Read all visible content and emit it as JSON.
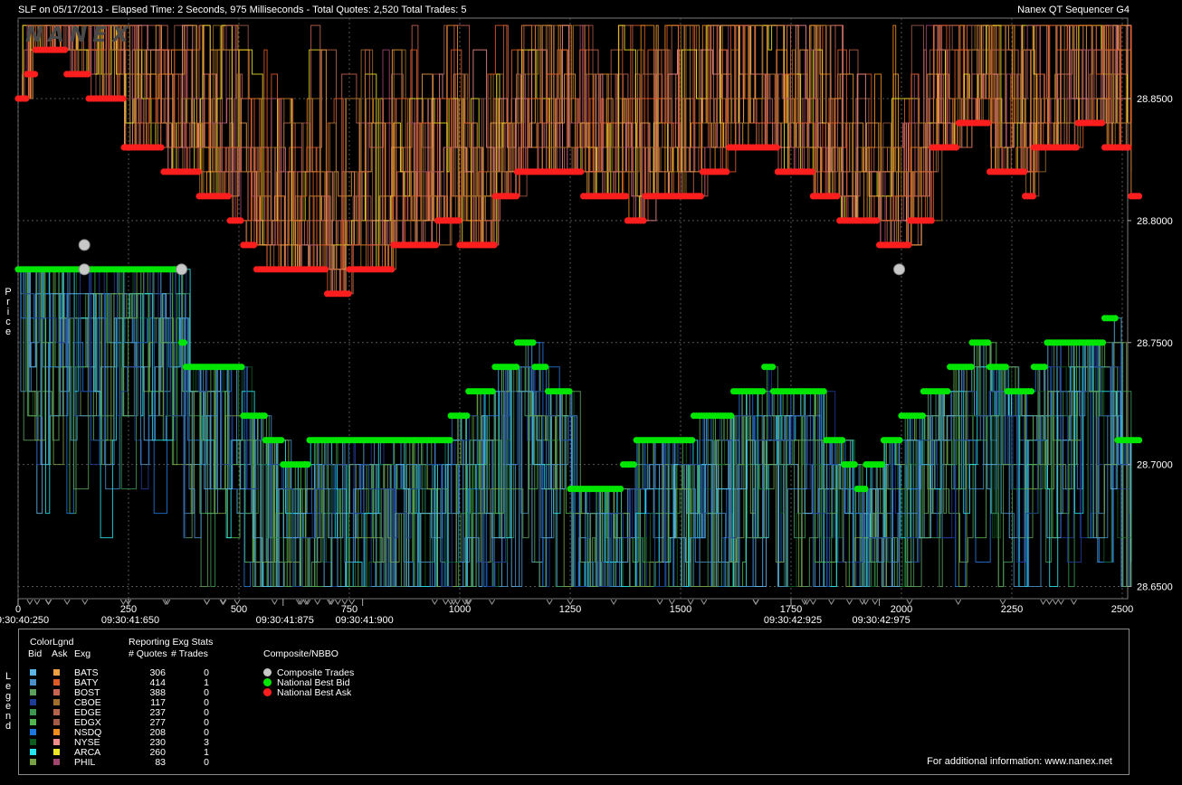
{
  "header": {
    "title": "SLF on 05/17/2013  -  Elapsed Time: 2 Seconds, 975 Milliseconds  -  Total Quotes: 2,520  Total Trades: 5",
    "brand": "Nanex QT Sequencer G4"
  },
  "logo_text": "NANEX",
  "side_labels": {
    "price": "Price",
    "legend": "Legend"
  },
  "chart_data": {
    "type": "line",
    "ylim": [
      28.645,
      28.883
    ],
    "xlim": [
      0,
      2520
    ],
    "y_ticks": [
      "28.6500",
      "28.7000",
      "28.7500",
      "28.8000",
      "28.8500"
    ],
    "x_ticks": [
      "0",
      "250",
      "500",
      "750",
      "1000",
      "1250",
      "1500",
      "1750",
      "2000",
      "2250",
      "2500"
    ],
    "time_labels": [
      {
        "seq": 0,
        "text": "09:30:40:250"
      },
      {
        "seq": 250,
        "text": "09:30:41:650"
      },
      {
        "seq": 600,
        "text": "09:30:41:875"
      },
      {
        "seq": 780,
        "text": "09:30:41:900"
      },
      {
        "seq": 1750,
        "text": "09:30:42:925"
      },
      {
        "seq": 1950,
        "text": "09:30:42:975"
      }
    ],
    "trades": [
      {
        "seq": 150,
        "price": 28.79
      },
      {
        "seq": 150,
        "price": 28.78
      },
      {
        "seq": 370,
        "price": 28.78
      },
      {
        "seq": 1995,
        "price": 28.78
      }
    ],
    "national_best_bid": [
      [
        0,
        28.78
      ],
      [
        370,
        28.75
      ],
      [
        380,
        28.74
      ],
      [
        510,
        28.72
      ],
      [
        560,
        28.71
      ],
      [
        600,
        28.7
      ],
      [
        650,
        28.7
      ],
      [
        660,
        28.71
      ],
      [
        980,
        28.72
      ],
      [
        1020,
        28.73
      ],
      [
        1080,
        28.74
      ],
      [
        1130,
        28.75
      ],
      [
        1170,
        28.74
      ],
      [
        1200,
        28.73
      ],
      [
        1250,
        28.69
      ],
      [
        1370,
        28.7
      ],
      [
        1400,
        28.71
      ],
      [
        1530,
        28.72
      ],
      [
        1620,
        28.73
      ],
      [
        1690,
        28.74
      ],
      [
        1710,
        28.73
      ],
      [
        1830,
        28.71
      ],
      [
        1870,
        28.7
      ],
      [
        1900,
        28.69
      ],
      [
        1920,
        28.7
      ],
      [
        1960,
        28.71
      ],
      [
        2000,
        28.72
      ],
      [
        2050,
        28.73
      ],
      [
        2110,
        28.74
      ],
      [
        2160,
        28.75
      ],
      [
        2200,
        28.74
      ],
      [
        2240,
        28.73
      ],
      [
        2300,
        28.74
      ],
      [
        2330,
        28.75
      ],
      [
        2460,
        28.76
      ],
      [
        2490,
        28.71
      ],
      [
        2540,
        28.71
      ]
    ],
    "national_best_ask": [
      [
        0,
        28.85
      ],
      [
        20,
        28.86
      ],
      [
        40,
        28.87
      ],
      [
        110,
        28.86
      ],
      [
        160,
        28.85
      ],
      [
        240,
        28.83
      ],
      [
        330,
        28.82
      ],
      [
        410,
        28.81
      ],
      [
        480,
        28.8
      ],
      [
        510,
        28.79
      ],
      [
        540,
        28.78
      ],
      [
        700,
        28.77
      ],
      [
        750,
        28.78
      ],
      [
        850,
        28.79
      ],
      [
        950,
        28.8
      ],
      [
        1000,
        28.79
      ],
      [
        1080,
        28.81
      ],
      [
        1130,
        28.82
      ],
      [
        1280,
        28.81
      ],
      [
        1380,
        28.8
      ],
      [
        1420,
        28.81
      ],
      [
        1550,
        28.82
      ],
      [
        1610,
        28.83
      ],
      [
        1720,
        28.82
      ],
      [
        1800,
        28.81
      ],
      [
        1860,
        28.8
      ],
      [
        1950,
        28.79
      ],
      [
        2020,
        28.8
      ],
      [
        2070,
        28.83
      ],
      [
        2130,
        28.84
      ],
      [
        2200,
        28.82
      ],
      [
        2280,
        28.81
      ],
      [
        2300,
        28.83
      ],
      [
        2400,
        28.84
      ],
      [
        2460,
        28.83
      ],
      [
        2520,
        28.81
      ],
      [
        2540,
        28.81
      ]
    ]
  },
  "legend": {
    "color_legend_title": "ColorLgnd",
    "bid_header": "Bid",
    "ask_header": "Ask",
    "exg_header": "Exg",
    "stats_title": "Reporting Exg Stats",
    "quotes_header": "# Quotes",
    "trades_header": "# Trades",
    "nbbo_title": "Composite/NBBO",
    "exchanges": [
      {
        "name": "BATS",
        "quotes": "306",
        "trades": "0",
        "bid_color": "#5fb4e6",
        "ask_color": "#f0a040"
      },
      {
        "name": "BATY",
        "quotes": "414",
        "trades": "1",
        "bid_color": "#4a8fc8",
        "ask_color": "#e05a28"
      },
      {
        "name": "BOST",
        "quotes": "388",
        "trades": "0",
        "bid_color": "#5aa05a",
        "ask_color": "#c86450"
      },
      {
        "name": "CBOE",
        "quotes": "117",
        "trades": "0",
        "bid_color": "#1e3c96",
        "ask_color": "#a06e28"
      },
      {
        "name": "EDGE",
        "quotes": "237",
        "trades": "0",
        "bid_color": "#3c9650",
        "ask_color": "#b4644b"
      },
      {
        "name": "EDGX",
        "quotes": "277",
        "trades": "0",
        "bid_color": "#50b450",
        "ask_color": "#a05a46"
      },
      {
        "name": "NSDQ",
        "quotes": "208",
        "trades": "0",
        "bid_color": "#1e78dc",
        "ask_color": "#f08c1e"
      },
      {
        "name": "NYSE",
        "quotes": "230",
        "trades": "3",
        "bid_color": "#0f5a1e",
        "ask_color": "#f08c8c"
      },
      {
        "name": "ARCA",
        "quotes": "260",
        "trades": "1",
        "bid_color": "#28e6f0",
        "ask_color": "#f0e628"
      },
      {
        "name": "PHIL",
        "quotes": "83",
        "trades": "0",
        "bid_color": "#78a046",
        "ask_color": "#a0466e"
      }
    ],
    "nbbo_items": [
      {
        "label": "Composite Trades",
        "color": "#c8c8c8"
      },
      {
        "label": "National Best Bid",
        "color": "#00e600"
      },
      {
        "label": "National Best Ask",
        "color": "#ff1e1e"
      }
    ]
  },
  "footer": {
    "info": "For additional information: www.nanex.net"
  }
}
